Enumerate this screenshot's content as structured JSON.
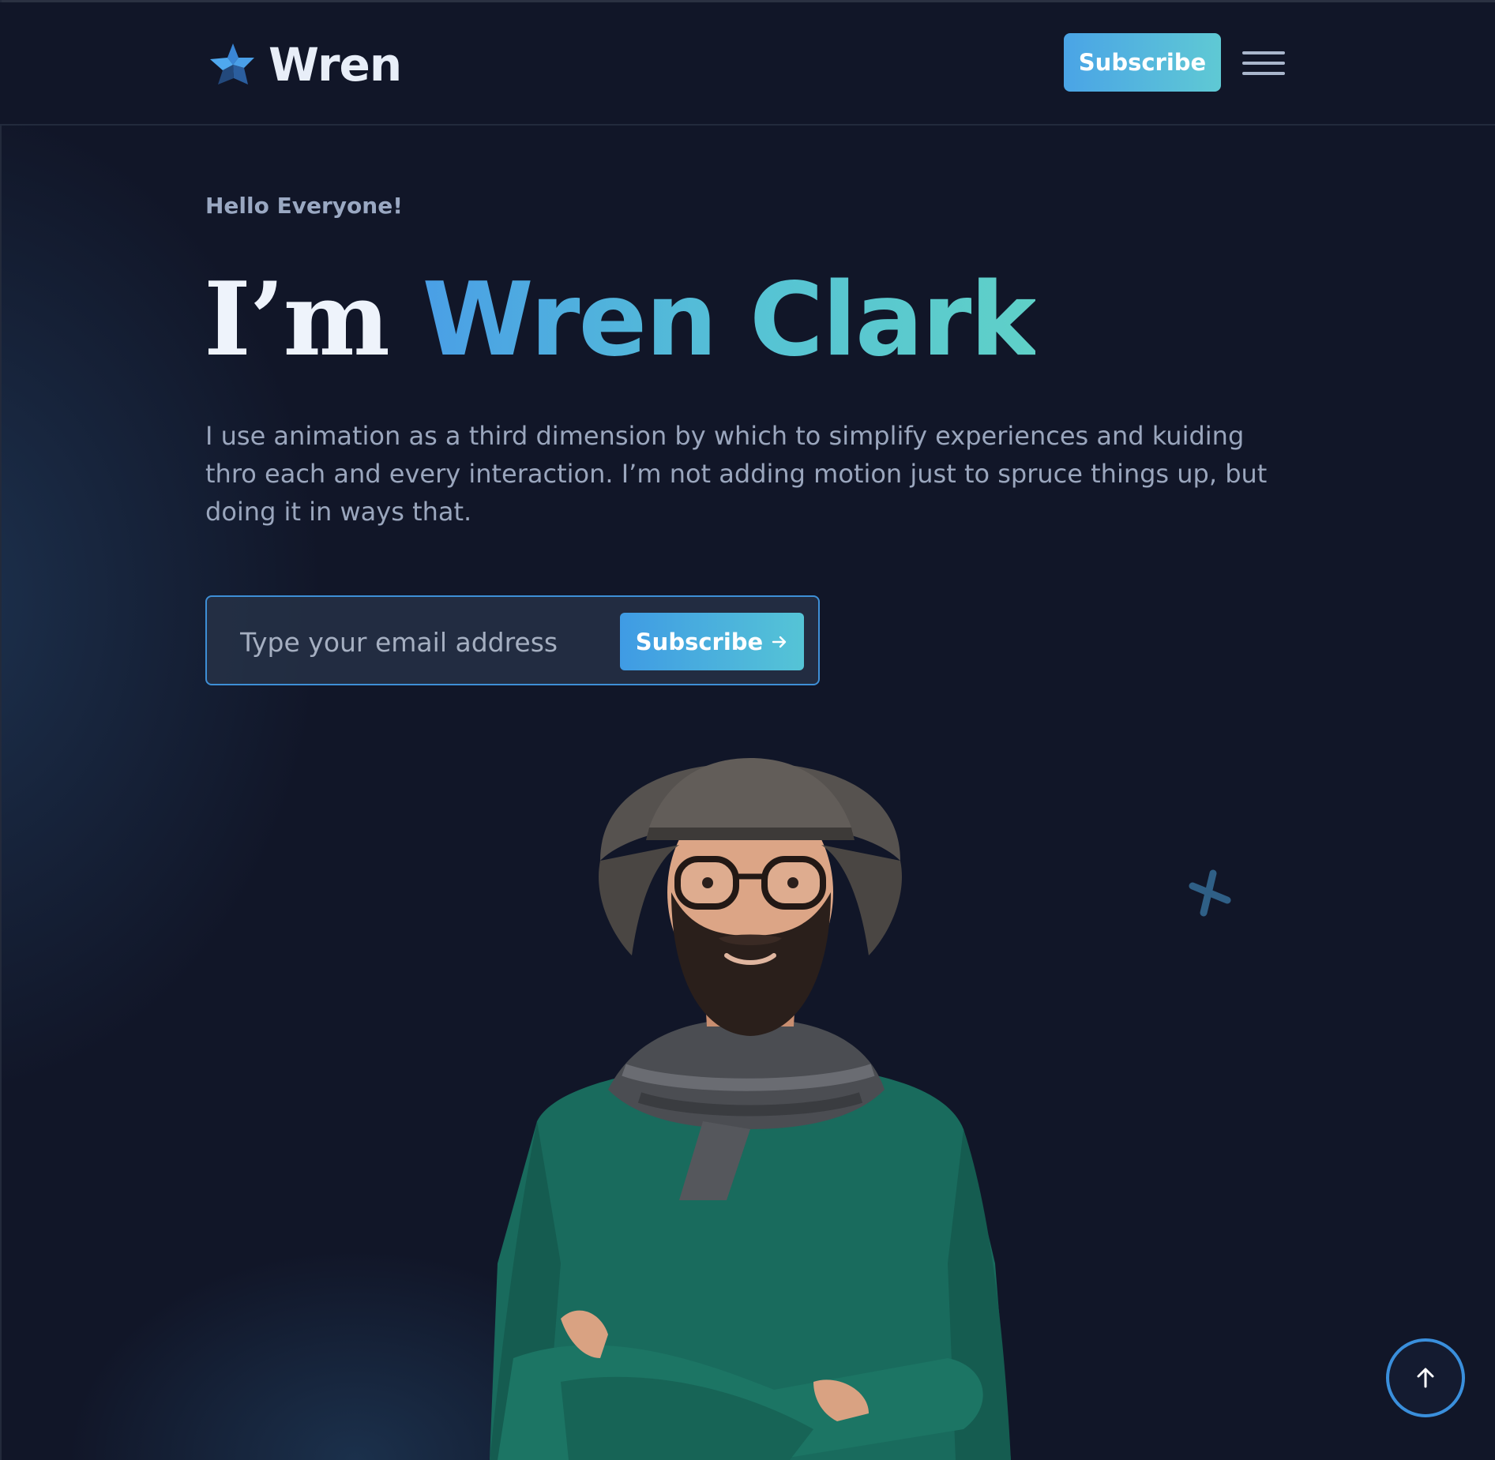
{
  "brand": {
    "name": "Wren",
    "logo_icon": "star-logo-icon"
  },
  "header": {
    "subscribe_label": "Subscribe",
    "menu_icon": "hamburger-menu-icon"
  },
  "hero": {
    "greeting": "Hello Everyone!",
    "headline_lead": "I’m ",
    "headline_name": "Wren Clark",
    "intro": "I use animation as a third dimension by which to simplify experiences and kuiding thro each and every interaction. I’m not adding motion just to spruce things up, but doing it in ways that."
  },
  "subscribe_form": {
    "email_placeholder": "Type your email address",
    "email_value": "",
    "button_label": "Subscribe",
    "button_icon": "arrow-right-icon"
  },
  "decor": {
    "portrait_alt": "portrait photo",
    "cross_icon": "cross-icon"
  },
  "scroll_top": {
    "icon": "arrow-up-icon"
  },
  "colors": {
    "background": "#111628",
    "accent_blue": "#4aa4e6",
    "accent_teal": "#5fc9d4",
    "heading": "#eef3fb",
    "body_text": "#9aa6bd"
  }
}
